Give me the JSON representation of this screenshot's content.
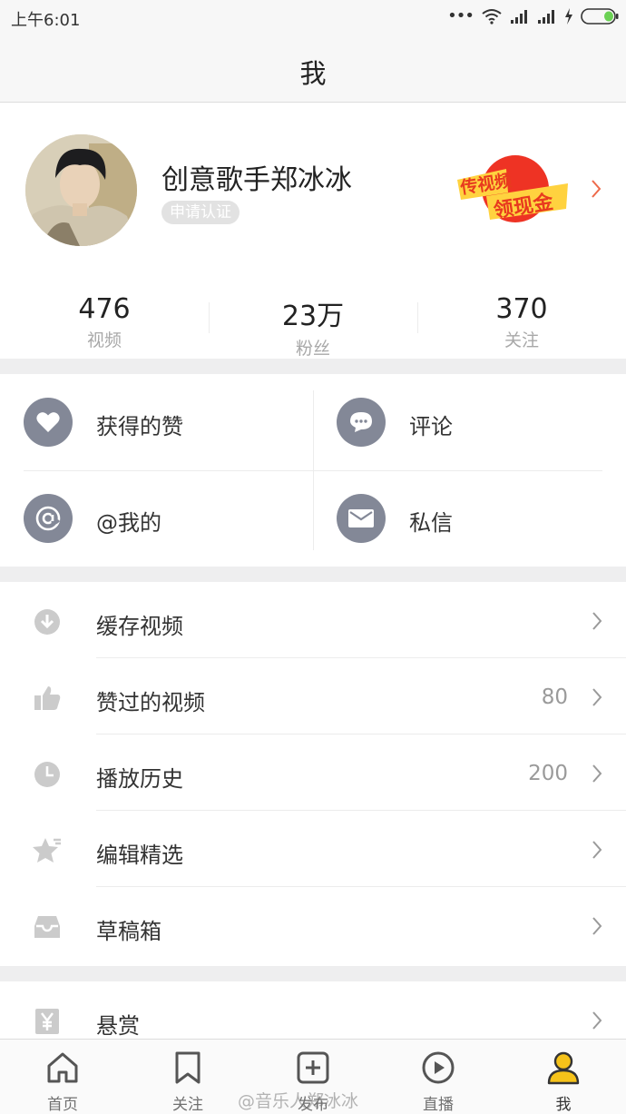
{
  "status_bar": {
    "time": "上午6:01"
  },
  "header": {
    "title": "我"
  },
  "profile": {
    "username": "创意歌手郑冰冰",
    "verify_label": "申请认证",
    "promo": {
      "line1": "传视频",
      "line2": "领现金"
    }
  },
  "stats": [
    {
      "value": "476",
      "label": "视频"
    },
    {
      "value": "23万",
      "label": "粉丝"
    },
    {
      "value": "370",
      "label": "关注"
    }
  ],
  "grid": [
    {
      "label": "获得的赞",
      "icon": "heart-icon"
    },
    {
      "label": "评论",
      "icon": "comment-icon"
    },
    {
      "label": "@我的",
      "icon": "at-icon"
    },
    {
      "label": "私信",
      "icon": "mail-icon"
    }
  ],
  "menu": [
    {
      "label": "缓存视频",
      "count": "",
      "icon": "download-icon"
    },
    {
      "label": "赞过的视频",
      "count": "80",
      "icon": "thumbs-up-icon"
    },
    {
      "label": "播放历史",
      "count": "200",
      "icon": "clock-icon"
    },
    {
      "label": "编辑精选",
      "count": "",
      "icon": "star-icon"
    },
    {
      "label": "草稿箱",
      "count": "",
      "icon": "inbox-icon"
    }
  ],
  "menu2": [
    {
      "label": "悬赏",
      "icon": "yen-icon"
    }
  ],
  "tabs": [
    {
      "label": "首页",
      "icon": "home-icon"
    },
    {
      "label": "关注",
      "icon": "bookmark-icon"
    },
    {
      "label": "发布",
      "icon": "add-icon"
    },
    {
      "label": "直播",
      "icon": "play-icon"
    },
    {
      "label": "我",
      "icon": "user-icon",
      "active": true
    }
  ],
  "watermark": "@音乐人郑冰冰",
  "colors": {
    "accent": "#f6c31a",
    "grid_icon": "#838897",
    "menu_icon": "#cbcbcb"
  }
}
